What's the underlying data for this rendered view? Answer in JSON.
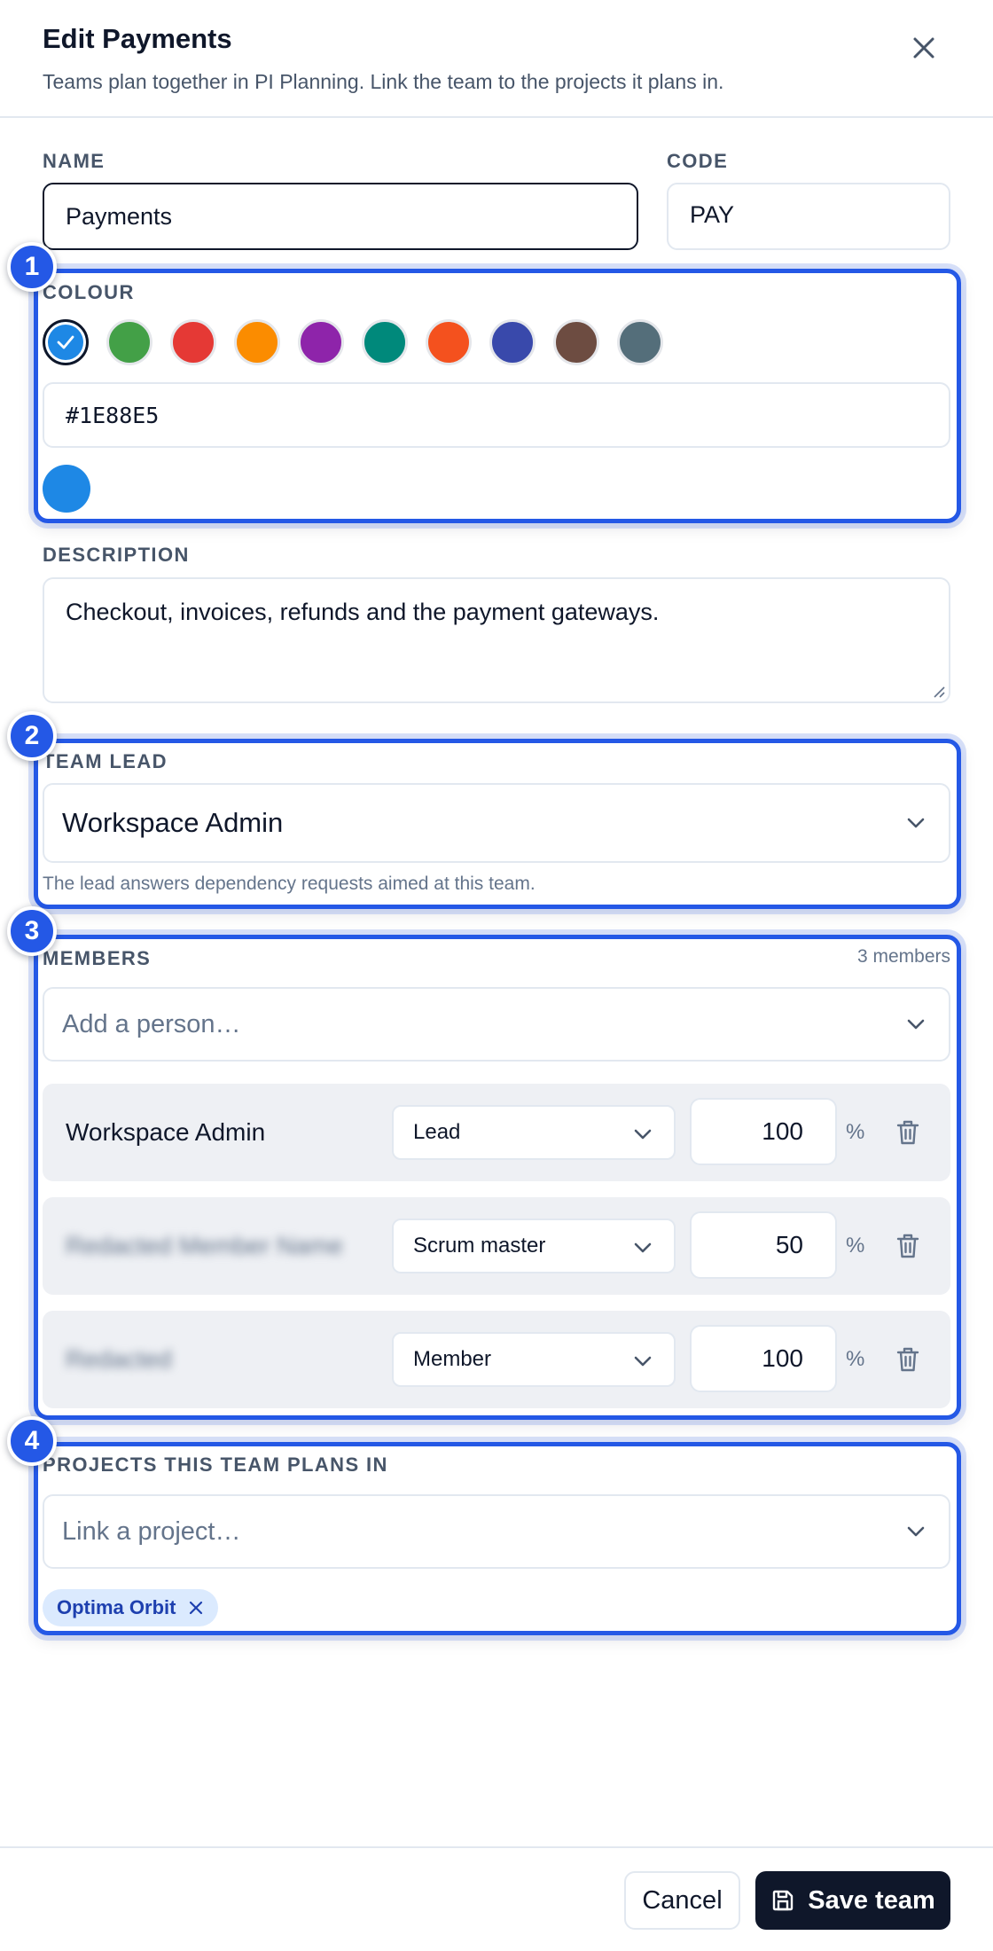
{
  "dialog": {
    "title": "Edit Payments",
    "subtitle": "Teams plan together in PI Planning. Link the team to the projects it plans in."
  },
  "fields": {
    "name": {
      "label": "NAME",
      "value": "Payments"
    },
    "code": {
      "label": "CODE",
      "value": "PAY"
    },
    "colour": {
      "label": "COLOUR",
      "value": "#1E88E5",
      "swatches": [
        "#1E88E5",
        "#43A047",
        "#E53935",
        "#FB8C00",
        "#8E24AA",
        "#00897B",
        "#F4511E",
        "#3949AB",
        "#6D4C41",
        "#546E7A"
      ],
      "selected_index": 0
    },
    "description": {
      "label": "DESCRIPTION",
      "value": "Checkout, invoices, refunds and the payment gateways."
    },
    "team_lead": {
      "label": "TEAM LEAD",
      "value": "Workspace Admin",
      "help": "The lead answers dependency requests aimed at this team."
    },
    "members": {
      "label": "MEMBERS",
      "count_text": "3 members",
      "placeholder": "Add a person…",
      "rows": [
        {
          "name": "Workspace Admin",
          "role": "Lead",
          "allocation": "100",
          "blurred": false
        },
        {
          "name": "Redacted Member Name",
          "role": "Scrum master",
          "allocation": "50",
          "blurred": true
        },
        {
          "name": "Redacted",
          "role": "Member",
          "allocation": "100",
          "blurred": true
        }
      ],
      "percent_sign": "%"
    },
    "projects": {
      "label": "PROJECTS THIS TEAM PLANS IN",
      "placeholder": "Link a project…",
      "chips": [
        "Optima Orbit"
      ]
    }
  },
  "annotations": [
    "1",
    "2",
    "3",
    "4"
  ],
  "footer": {
    "cancel_label": "Cancel",
    "save_label": "Save team"
  },
  "colors": {
    "accent": "#2458E6",
    "primary_button": "#0F172A",
    "chip_bg": "#DBEAFE",
    "chip_text": "#1E40AF",
    "row_bg": "#EEF0F4"
  }
}
